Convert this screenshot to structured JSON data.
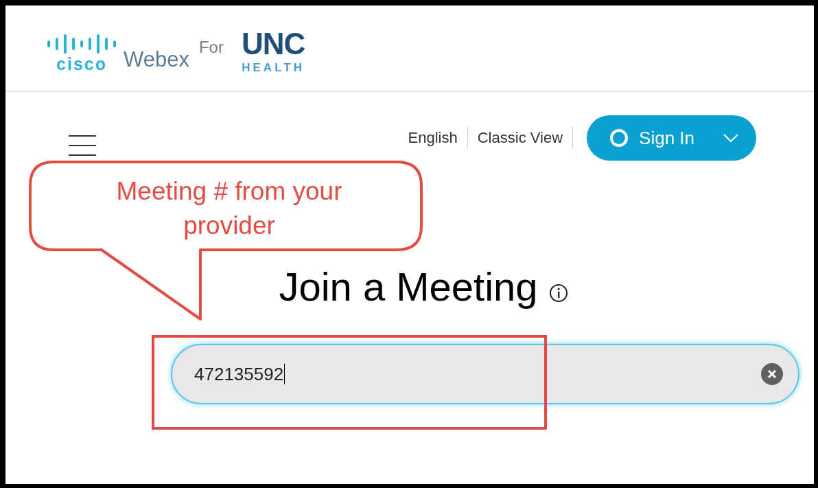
{
  "header": {
    "brand": "cisco",
    "product": "Webex",
    "connector": "For",
    "partner": "UNC",
    "partner_sub": "HEALTH"
  },
  "nav": {
    "links": [
      "English",
      "Classic View"
    ],
    "sign_in": "Sign In"
  },
  "heading": "Join a Meeting",
  "meeting_field": {
    "value": "472135592"
  },
  "annotation": {
    "callout": "Meeting # from your provider"
  }
}
